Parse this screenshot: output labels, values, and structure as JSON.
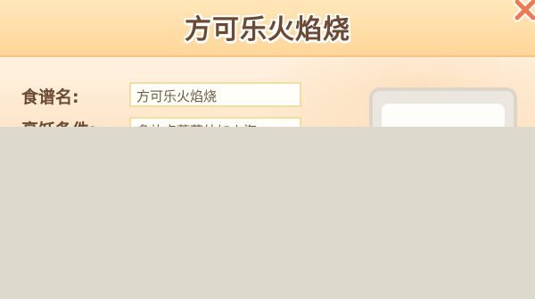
{
  "dialog": {
    "title": "方可乐火焰烧",
    "close_icon": "close-x-icon",
    "colors": {
      "title_bar": "#ffd69a",
      "title_text": "#6a4a35",
      "label_text": "#6a4a35",
      "field_border": "#f0dfa3",
      "close_icon": "#ec7a52",
      "obscured_area": "#ddd9cc"
    }
  },
  "form": {
    "recipe_name_label": "食谱名:",
    "recipe_name_value": "方可乐火焰烧",
    "cooking_condition_label": "烹饪条件:",
    "cooking_condition_value": "多放点蘑菇外加火海"
  }
}
